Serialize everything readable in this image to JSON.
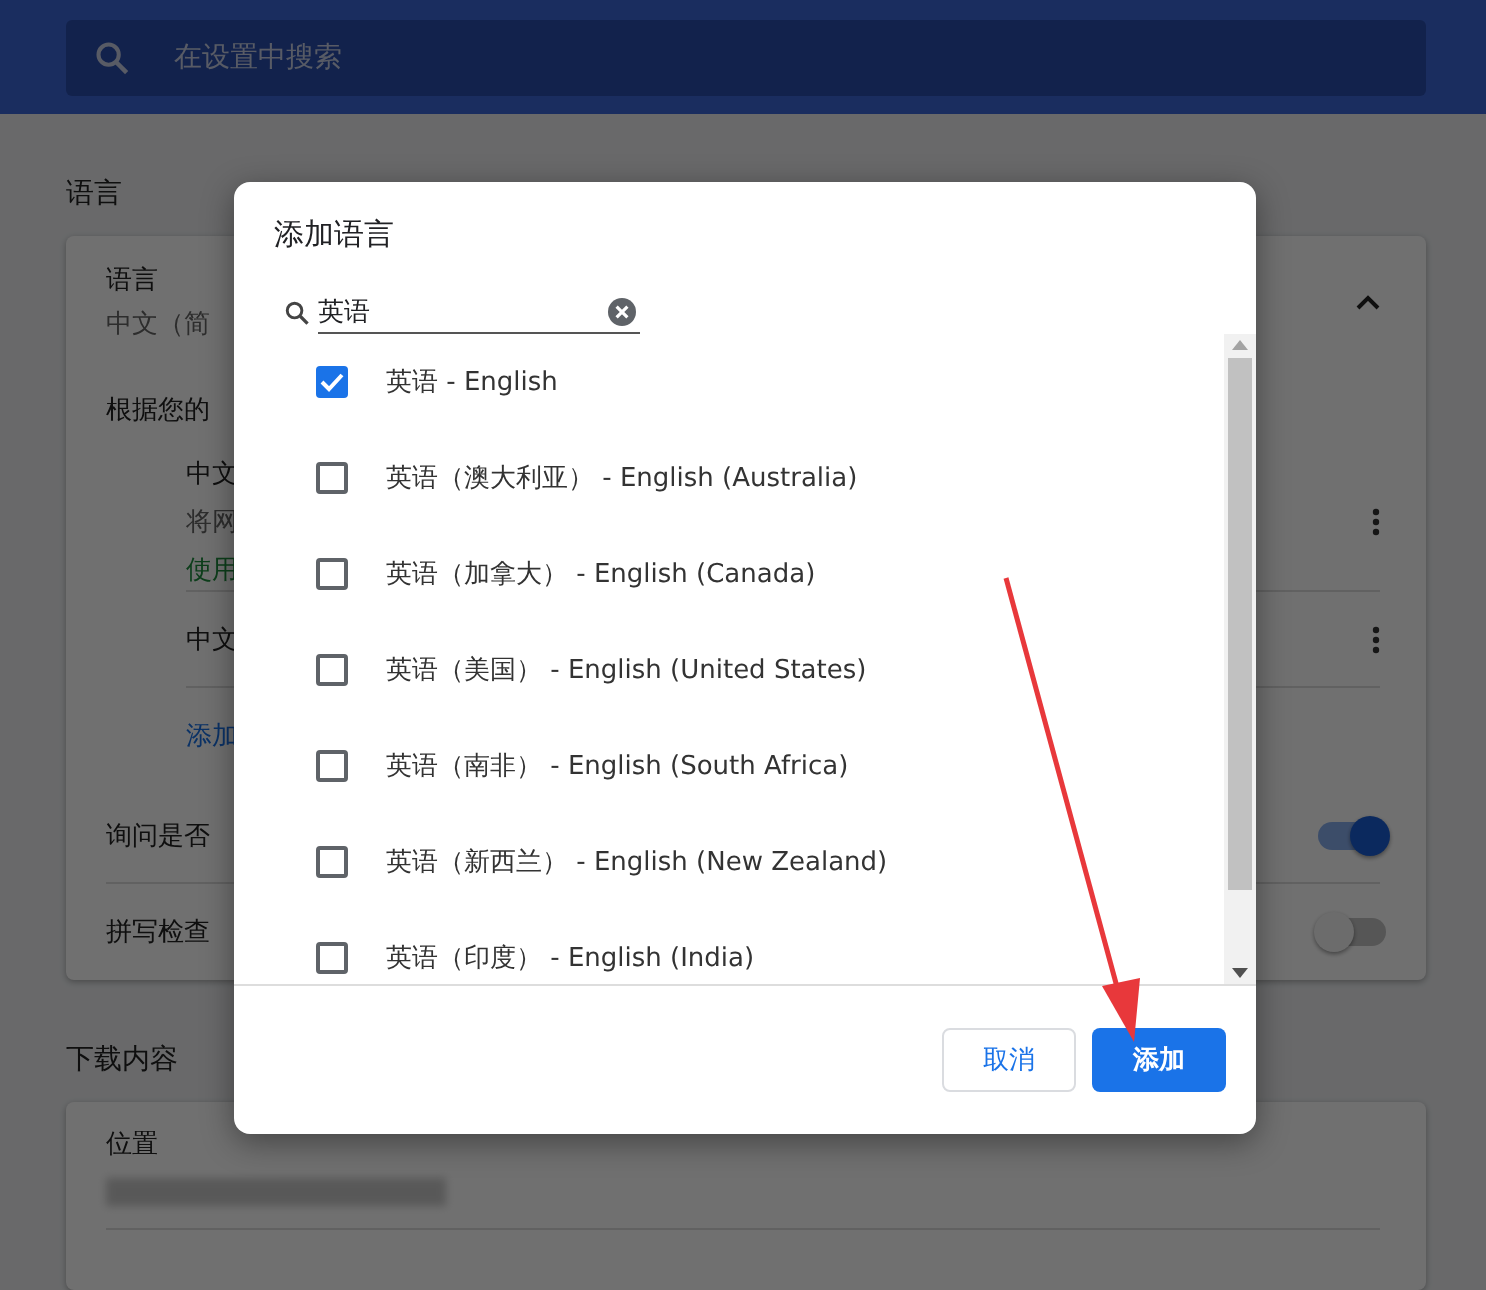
{
  "search": {
    "placeholder": "在设置中搜索"
  },
  "language_section": {
    "heading": "语言",
    "title": "语言",
    "subtitle": "中文（简",
    "expanded": true,
    "order_label": "根据您的",
    "languages": [
      {
        "name": "中文",
        "lines": [
          {
            "text": "将网",
            "kind": "note"
          },
          {
            "text": "使用",
            "kind": "status"
          }
        ]
      },
      {
        "name": "中文"
      }
    ],
    "add_link": "添加",
    "toggles": [
      {
        "label": "询问是否",
        "on": true
      },
      {
        "label": "拼写检查",
        "on": false
      }
    ]
  },
  "downloads_section": {
    "heading": "下载内容",
    "location_label": "位置"
  },
  "dialog": {
    "title": "添加语言",
    "search": {
      "value": "英语"
    },
    "options": [
      {
        "label": "英语 - English",
        "checked": true
      },
      {
        "label": "英语（澳大利亚） - English (Australia)",
        "checked": false
      },
      {
        "label": "英语（加拿大） - English (Canada)",
        "checked": false
      },
      {
        "label": "英语（美国） - English (United States)",
        "checked": false
      },
      {
        "label": "英语（南非） - English (South Africa)",
        "checked": false
      },
      {
        "label": "英语（新西兰） - English (New Zealand)",
        "checked": false
      },
      {
        "label": "英语（印度） - English (India)",
        "checked": false
      }
    ],
    "buttons": [
      {
        "label": "取消",
        "kind": "secondary"
      },
      {
        "label": "添加",
        "kind": "primary"
      }
    ]
  }
}
